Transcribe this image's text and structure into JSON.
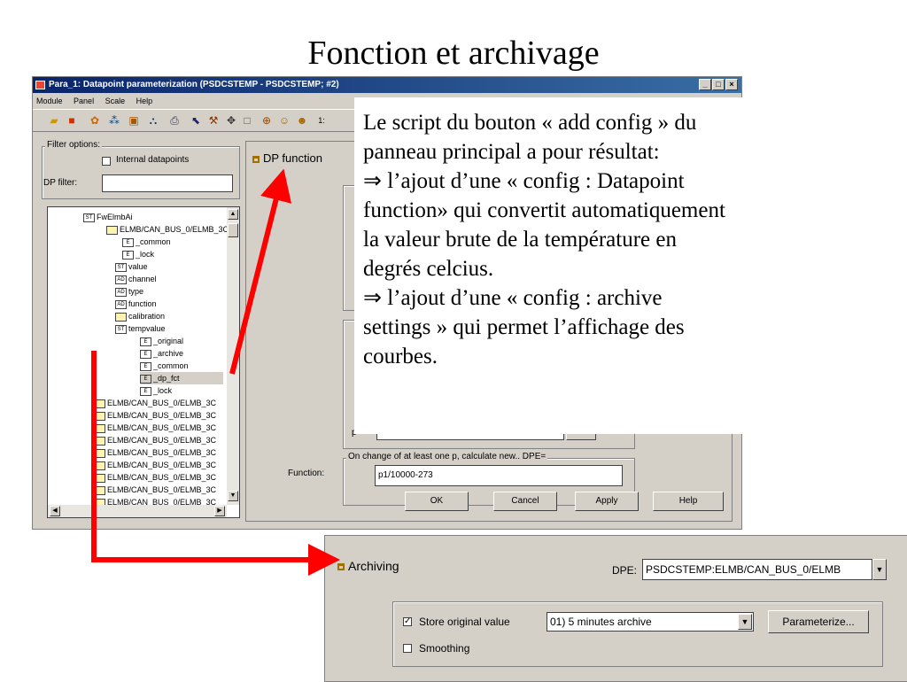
{
  "slide": {
    "title": "Fonction et archivage"
  },
  "window": {
    "title": "Para_1: Datapoint parameterization (PSDCSTEMP - PSDCSTEMP; #2)",
    "controls": [
      "_",
      "□",
      "×"
    ],
    "menu": [
      "Module",
      "Panel",
      "Scale",
      "Help"
    ]
  },
  "filter": {
    "group_label": "Filter options:",
    "internal_label": "Internal datapoints",
    "dp_filter_label": "DP filter:",
    "dp_filter_value": ""
  },
  "tree": {
    "items": [
      {
        "label": "FwElmbAi",
        "prefix": "ST"
      },
      {
        "label": "ELMB/CAN_BUS_0/ELMB_3C",
        "prefix": ""
      },
      {
        "label": "_common",
        "prefix": "E"
      },
      {
        "label": "_lock",
        "prefix": "E"
      },
      {
        "label": "value",
        "prefix": "ST"
      },
      {
        "label": "channel",
        "prefix": "AD"
      },
      {
        "label": "type",
        "prefix": "AD"
      },
      {
        "label": "function",
        "prefix": "AD"
      },
      {
        "label": "calibration",
        "prefix": ""
      },
      {
        "label": "tempvalue",
        "prefix": "ST"
      },
      {
        "label": "_original",
        "prefix": "E"
      },
      {
        "label": "_archive",
        "prefix": "E"
      },
      {
        "label": "_common",
        "prefix": "E"
      },
      {
        "label": "_dp_fct",
        "prefix": "E"
      },
      {
        "label": "_lock",
        "prefix": "E"
      },
      {
        "label": "ELMB/CAN_BUS_0/ELMB_3C",
        "prefix": ""
      },
      {
        "label": "ELMB/CAN_BUS_0/ELMB_3C",
        "prefix": ""
      },
      {
        "label": "ELMB/CAN_BUS_0/ELMB_3C",
        "prefix": ""
      },
      {
        "label": "ELMB/CAN_BUS_0/ELMB_3C",
        "prefix": ""
      },
      {
        "label": "ELMB/CAN_BUS_0/ELMB_3C",
        "prefix": ""
      },
      {
        "label": "ELMB/CAN_BUS_0/ELMB_3C",
        "prefix": ""
      },
      {
        "label": "ELMB/CAN_BUS_0/ELMB_3C",
        "prefix": ""
      },
      {
        "label": "ELMB/CAN_BUS_0/ELMB_3C",
        "prefix": ""
      },
      {
        "label": "ELMB/CAN_BUS_0/ELMB_3C",
        "prefix": ""
      },
      {
        "label": "ELMB/CAN BUS 0/ELMB 3C",
        "prefix": ""
      }
    ]
  },
  "dp_function": {
    "title": "DP function",
    "change_group_label": "On change of at least one p, calculate new.. DPE=",
    "function_label": "Function:",
    "function_value": "p1/10000-273",
    "partial_label": "p",
    "buttons": {
      "ok": "OK",
      "cancel": "Cancel",
      "apply": "Apply",
      "help": "Help"
    }
  },
  "callout": {
    "lines": [
      "Le script du bouton « add config » du",
      "panneau principal a pour résultat:",
      "⇒ l’ajout d’une « config : Datapoint",
      "function»  qui convertit automatiquement",
      "la valeur brute de la température en",
      "degrés celcius.",
      "⇒ l’ajout d’une « config : archive",
      "settings » qui permet l’affichage des",
      "courbes."
    ]
  },
  "archiving": {
    "title": "Archiving",
    "dpe_label": "DPE:",
    "dpe_value": "PSDCSTEMP:ELMB/CAN_BUS_0/ELMB",
    "store_label": "Store original value",
    "store_checked": "✓",
    "archive_value": "01) 5 minutes archive",
    "parameterize_label": "Parameterize...",
    "smoothing_label": "Smoothing"
  },
  "colors": {
    "arrow": "#ff0000",
    "titlebar": "#0a246a",
    "window_bg": "#d4d0c8"
  }
}
